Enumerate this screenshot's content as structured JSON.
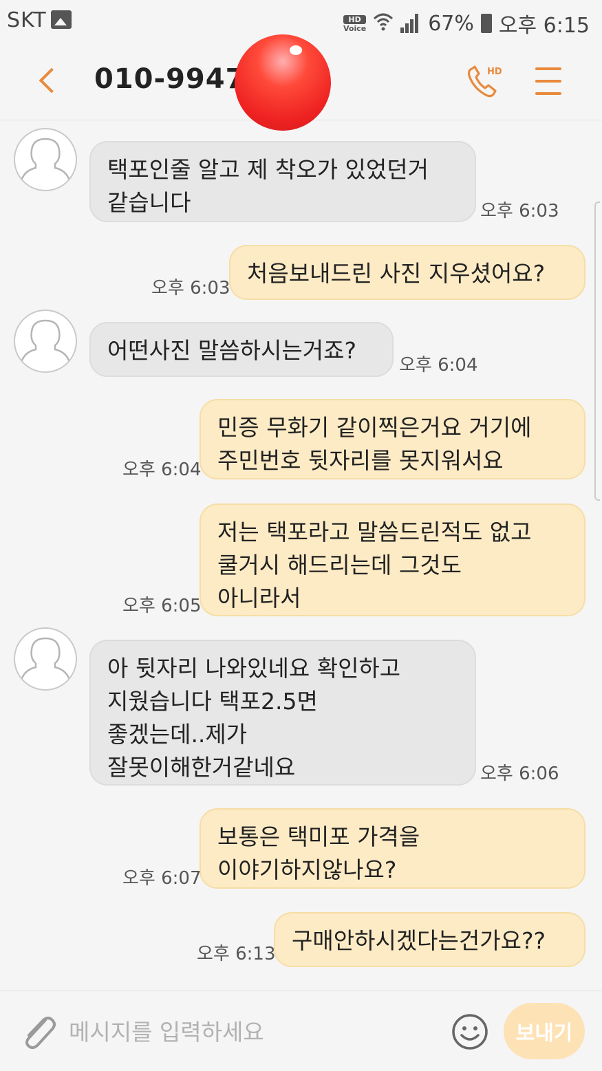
{
  "status_bar": {
    "carrier": "SKT",
    "hd_voice_top": "HD",
    "hd_voice_bottom": "Voice",
    "battery": "67%",
    "time": "오후 6:15"
  },
  "header": {
    "title": "010-9947-",
    "call_badge": "HD",
    "accent_color": "#e98a3c"
  },
  "messages": [
    {
      "dir": "in",
      "text": "택포인줄 알고 제 착오가 있었던거\n같습니다",
      "time": "오후 6:03"
    },
    {
      "dir": "out",
      "text": "처음보내드린 사진 지우셨어요?",
      "time": "오후 6:03"
    },
    {
      "dir": "in",
      "text": "어떤사진 말씀하시는거죠?",
      "time": "오후 6:04"
    },
    {
      "dir": "out",
      "text": "민증 무화기 같이찍은거요 거기에\n주민번호 뒷자리를 못지워서요",
      "time": "오후 6:04"
    },
    {
      "dir": "out",
      "text": "저는 택포라고 말씀드린적도 없고\n쿨거시 해드리는데 그것도\n아니라서",
      "time": "오후 6:05"
    },
    {
      "dir": "in",
      "text": "아 뒷자리 나와있네요 확인하고\n지웠습니다 택포2.5면\n좋겠는데..제가\n잘못이해한거같네요",
      "time": "오후 6:06"
    },
    {
      "dir": "out",
      "text": "보통은 택미포 가격을\n이야기하지않나요?",
      "time": "오후 6:07"
    },
    {
      "dir": "out",
      "text": "구매안하시겠다는건가요??",
      "time": "오후 6:13"
    }
  ],
  "input": {
    "placeholder": "메시지를 입력하세요",
    "send_label": "보내기"
  },
  "colors": {
    "incoming_bubble": "#e7e7e7",
    "outgoing_bubble": "#fdebc5",
    "send_button": "#fde2b6"
  }
}
